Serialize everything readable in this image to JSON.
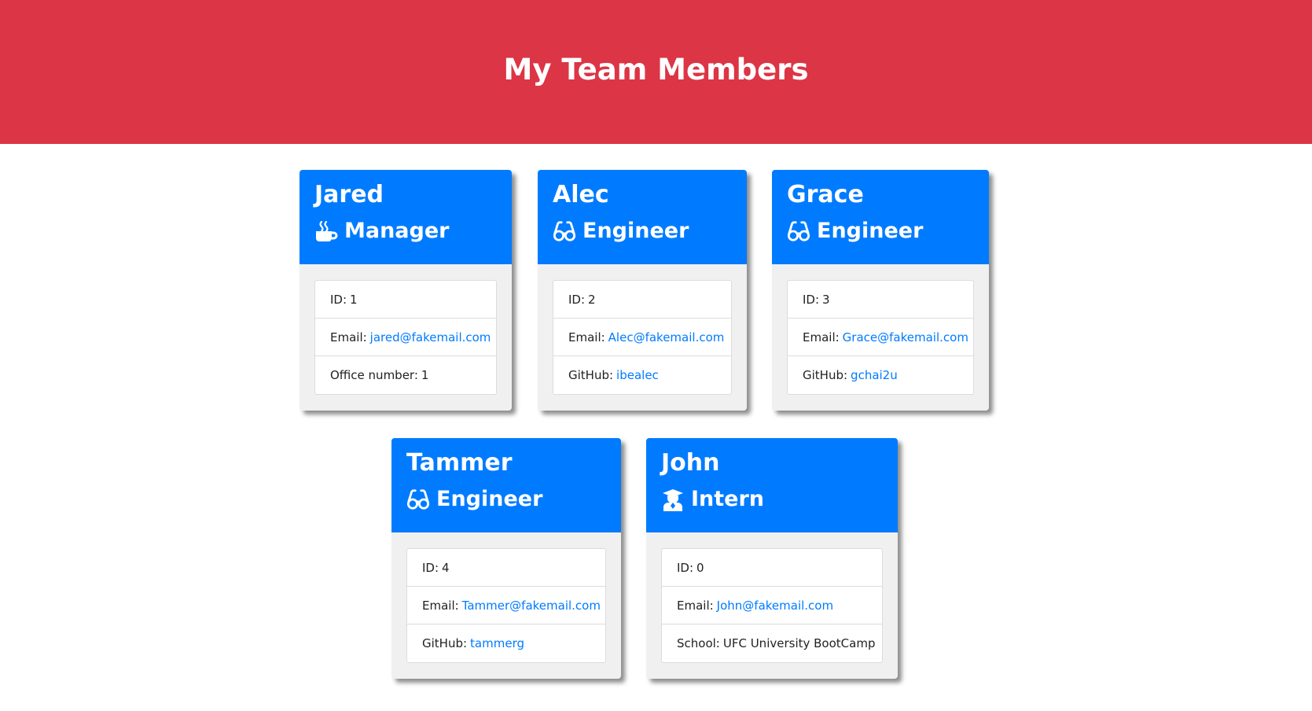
{
  "header": {
    "title": "My Team Members"
  },
  "colors": {
    "header_bg": "#dc3545",
    "card_head_bg": "#007bff",
    "link": "#007bff"
  },
  "cards": [
    {
      "name": "Jared",
      "role": "Manager",
      "role_icon": "mug-hot-icon",
      "id_label": "ID:",
      "id": "1",
      "email_label": "Email:",
      "email": "jared@fakemail.com",
      "extra_label": "Office number:",
      "extra_value": "1"
    },
    {
      "name": "Alec",
      "role": "Engineer",
      "role_icon": "glasses-icon",
      "id_label": "ID:",
      "id": "2",
      "email_label": "Email:",
      "email": "Alec@fakemail.com",
      "extra_label": "GitHub:",
      "extra_value": "ibealec"
    },
    {
      "name": "Grace",
      "role": "Engineer",
      "role_icon": "glasses-icon",
      "id_label": "ID:",
      "id": "3",
      "email_label": "Email:",
      "email": "Grace@fakemail.com",
      "extra_label": "GitHub:",
      "extra_value": "gchai2u"
    },
    {
      "name": "Tammer",
      "role": "Engineer",
      "role_icon": "glasses-icon",
      "id_label": "ID:",
      "id": "4",
      "email_label": "Email:",
      "email": "Tammer@fakemail.com",
      "extra_label": "GitHub:",
      "extra_value": "tammerg"
    },
    {
      "name": "John",
      "role": "Intern",
      "role_icon": "graduate-icon",
      "id_label": "ID:",
      "id": "0",
      "email_label": "Email:",
      "email": "John@fakemail.com",
      "extra_label": "School:",
      "extra_value": "UFC University BootCamp"
    }
  ]
}
